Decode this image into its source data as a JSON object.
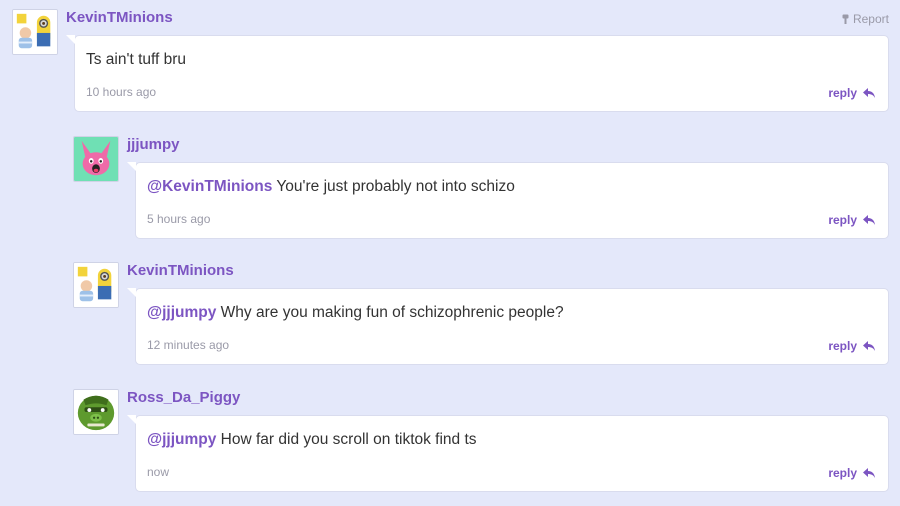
{
  "report_label": "Report",
  "reply_label": "reply",
  "comments": [
    {
      "username": "KevinTMinions",
      "avatar_icon": "minions-avatar-icon",
      "mention": "",
      "text": "Ts ain't tuff bru",
      "time": "10 hours ago"
    },
    {
      "username": "jjjumpy",
      "avatar_icon": "pink-bunny-avatar-icon",
      "mention": "@KevinTMinions",
      "text": " You're just probably not into schizo",
      "time": "5 hours ago"
    },
    {
      "username": "KevinTMinions",
      "avatar_icon": "minions-avatar-icon",
      "mention": "@jjjumpy",
      "text": " Why are you making fun of schizophrenic people?",
      "time": "12 minutes ago"
    },
    {
      "username": "Ross_Da_Piggy",
      "avatar_icon": "green-pig-avatar-icon",
      "mention": "@jjjumpy",
      "text": " How far did you scroll on tiktok find ts",
      "time": "now"
    }
  ],
  "colors": {
    "background": "#e4e8fa",
    "accent": "#7c55c2",
    "muted": "#9a9aa8"
  }
}
